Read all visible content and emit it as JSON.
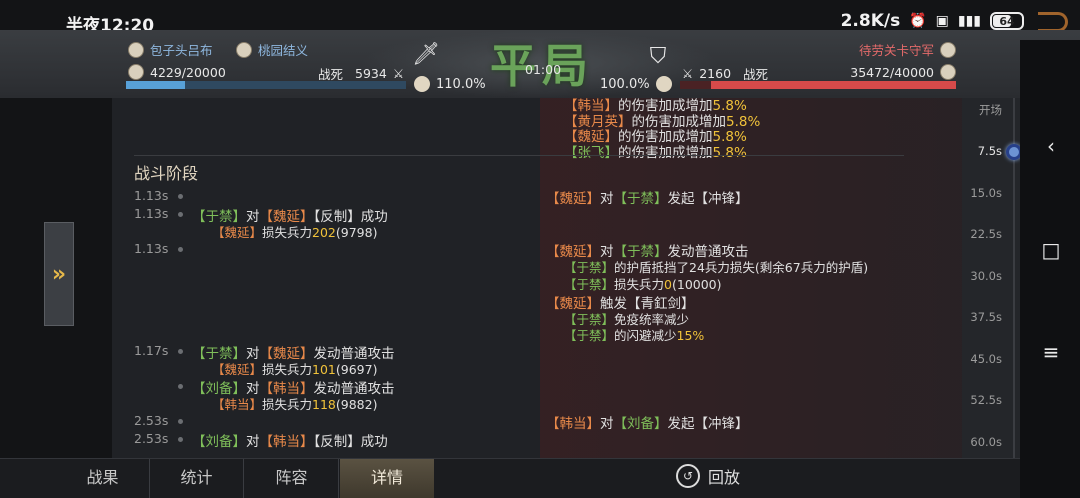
{
  "status": {
    "time": "半夜12:20",
    "speed": "2.8K/s",
    "battery": "64",
    "battery_level": 0.64
  },
  "header": {
    "left_player": "包子头吕布",
    "left_team": "桃园结义",
    "left_troops": "4229/20000",
    "left_troops_fraction": 0.211,
    "left_dead_label": "战死",
    "left_dead": "5934",
    "left_pct": "110.0%",
    "title_art": "平局",
    "timer": "01:00",
    "right_player": "待劳关卡守军",
    "right_dead": "2160",
    "right_dead_label": "战死",
    "right_troops": "35472/40000",
    "right_troops_fraction": 0.887,
    "right_pct": "100.0%"
  },
  "log": {
    "top_lines": [
      {
        "name": "【韩当】",
        "text": "的伤害加成增加",
        "value": "5.8%"
      },
      {
        "name": "【黄月英】",
        "text": "的伤害加成增加",
        "value": "5.8%"
      },
      {
        "name": "【魏延】",
        "text": "的伤害加成增加",
        "value": "5.8%"
      },
      {
        "name": "【张飞】",
        "text": "的伤害加成增加",
        "value": "5.8%"
      }
    ],
    "stage_title": "战斗阶段",
    "e1": {
      "time": "1.13s",
      "a": "【魏延】",
      "mid": "对",
      "b": "【于禁】",
      "act": "发起【冲锋】"
    },
    "e2": {
      "time": "1.13s",
      "a": "【于禁】",
      "mid": "对",
      "b": "【魏延】",
      "act": "【反制】成功",
      "sub_name": "【魏延】",
      "sub_text": "损失兵力",
      "sub_val": "202",
      "sub_rest": "(9798)"
    },
    "e3": {
      "time": "1.13s",
      "a": "【魏延】",
      "mid": "对",
      "b": "【于禁】",
      "act": "发动普通攻击",
      "l1_name": "【于禁】",
      "l1_text": "的护盾抵挡了24兵力损失(剩余67兵力的护盾)",
      "l2_name": "【于禁】",
      "l2_text": "损失兵力",
      "l2_val": "0",
      "l2_rest": "(10000)",
      "l3_name": "【魏延】",
      "l3_text": "触发【青釭剑】",
      "l4_name": "【于禁】",
      "l4_text": "免疫统率减少",
      "l5_name": "【于禁】",
      "l5_text": "的闪避减少",
      "l5_val": "15%"
    },
    "e4": {
      "time": "1.17s",
      "a": "【于禁】",
      "mid": "对",
      "b": "【魏延】",
      "act": "发动普通攻击",
      "sub_name": "【魏延】",
      "sub_text": "损失兵力",
      "sub_val": "101",
      "sub_rest": "(9697)"
    },
    "e5": {
      "a": "【刘备】",
      "mid": "对",
      "b": "【韩当】",
      "act": "发动普通攻击",
      "sub_name": "【韩当】",
      "sub_text": "损失兵力",
      "sub_val": "118",
      "sub_rest": "(9882)"
    },
    "e6": {
      "time": "2.53s",
      "a": "【韩当】",
      "mid": "对",
      "b": "【刘备】",
      "act": "发起【冲锋】"
    },
    "e7": {
      "time": "2.53s",
      "a": "【刘备】",
      "mid": "对",
      "b": "【韩当】",
      "act": "【反制】成功"
    }
  },
  "timeline": [
    "开场",
    "7.5s",
    "15.0s",
    "22.5s",
    "30.0s",
    "37.5s",
    "45.0s",
    "52.5s",
    "60.0s"
  ],
  "tabs": [
    "战果",
    "统计",
    "阵容",
    "详情"
  ],
  "replay_label": "回放"
}
